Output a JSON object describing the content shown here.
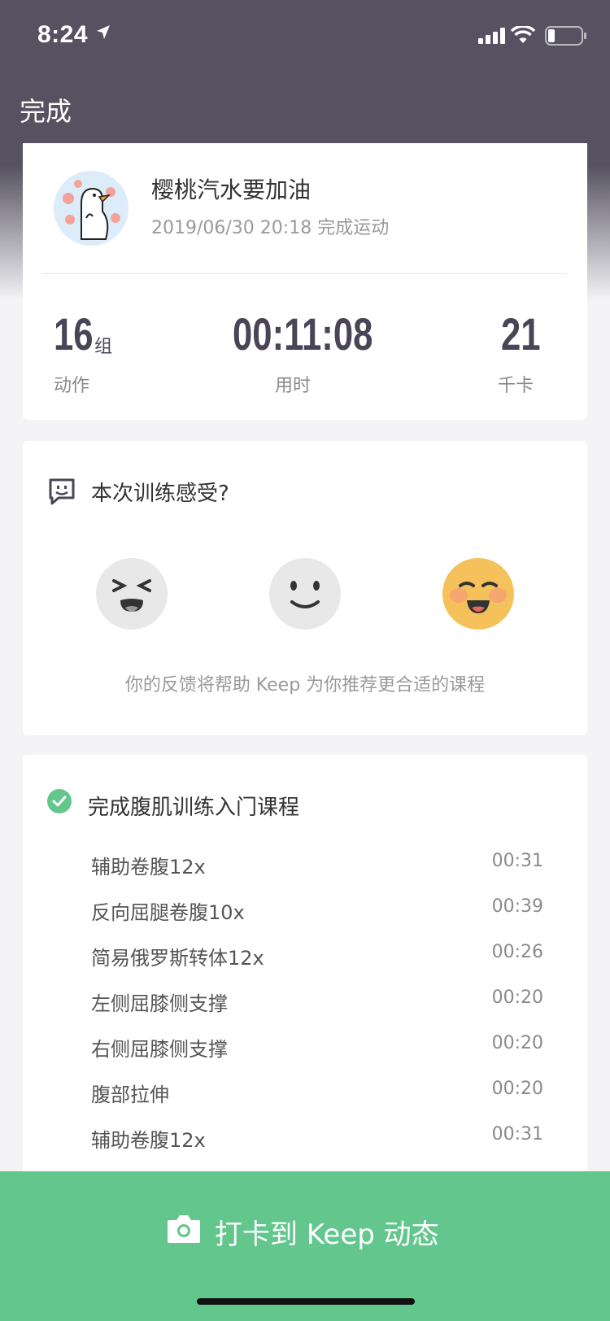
{
  "status_bar": {
    "time": "8:24"
  },
  "nav": {
    "done_label": "完成"
  },
  "profile": {
    "name": "樱桃汽水要加油",
    "subtitle": "2019/06/30 20:18 完成运动"
  },
  "stats": {
    "actions": {
      "value": "16",
      "unit": "组",
      "label": "动作"
    },
    "duration": {
      "value": "00:11:08",
      "label": "用时"
    },
    "calories": {
      "value": "21",
      "label": "千卡"
    }
  },
  "feedback": {
    "title": "本次训练感受?",
    "hint": "你的反馈将帮助 Keep 为你推荐更合适的课程",
    "options": [
      "hard-face-icon",
      "ok-face-icon",
      "happy-face-icon"
    ],
    "selected": "happy-face-icon"
  },
  "course": {
    "title": "完成腹肌训练入门课程",
    "exercises": [
      {
        "name": "辅助卷腹12x",
        "duration": "00:31"
      },
      {
        "name": "反向屈腿卷腹10x",
        "duration": "00:39"
      },
      {
        "name": "简易俄罗斯转体12x",
        "duration": "00:26"
      },
      {
        "name": "左侧屈膝侧支撑",
        "duration": "00:20"
      },
      {
        "name": "右侧屈膝侧支撑",
        "duration": "00:20"
      },
      {
        "name": "腹部拉伸",
        "duration": "00:20"
      },
      {
        "name": "辅助卷腹12x",
        "duration": "00:31"
      }
    ]
  },
  "checkin": {
    "label": "打卡到 Keep 动态"
  },
  "colors": {
    "header": "#565261",
    "accent": "#62c68d",
    "selected_emoji": "#f5c15a"
  }
}
